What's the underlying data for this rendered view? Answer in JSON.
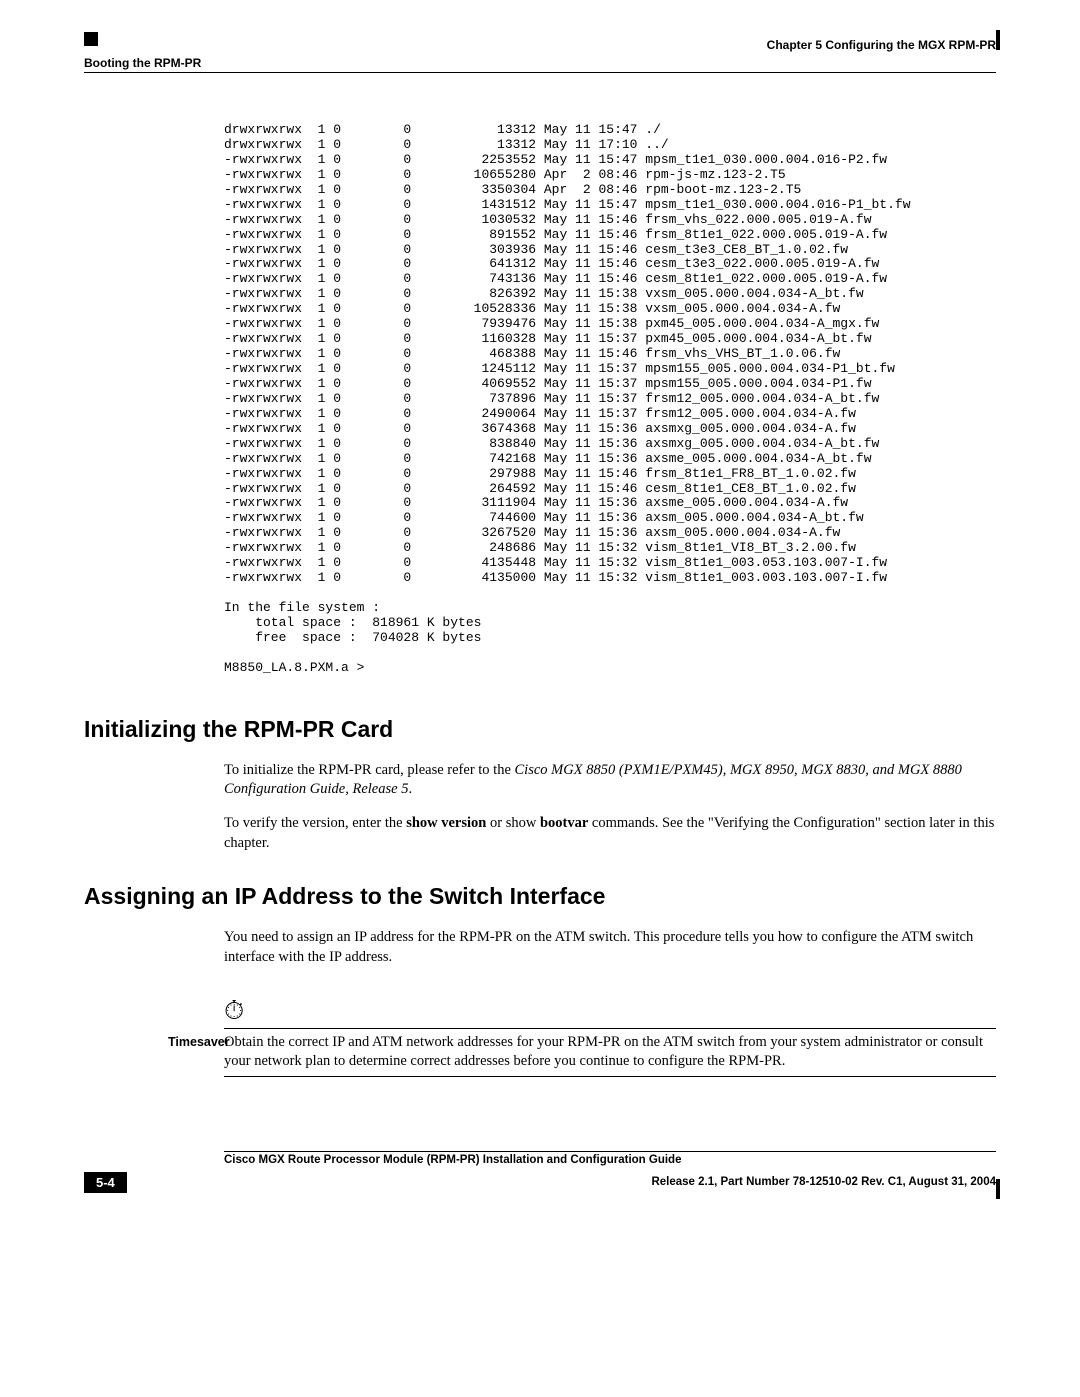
{
  "header": {
    "chapter_line": "Chapter 5    Configuring the MGX RPM-PR",
    "section_title": "Booting the RPM-PR"
  },
  "listing": {
    "rows": [
      {
        "perm": "drwxrwxrwx",
        "l": "1",
        "o": "0",
        "g": "0",
        "size": "13312",
        "date": "May 11 15:47",
        "name": "./"
      },
      {
        "perm": "drwxrwxrwx",
        "l": "1",
        "o": "0",
        "g": "0",
        "size": "13312",
        "date": "May 11 17:10",
        "name": "../"
      },
      {
        "perm": "-rwxrwxrwx",
        "l": "1",
        "o": "0",
        "g": "0",
        "size": "2253552",
        "date": "May 11 15:47",
        "name": "mpsm_t1e1_030.000.004.016-P2.fw"
      },
      {
        "perm": "-rwxrwxrwx",
        "l": "1",
        "o": "0",
        "g": "0",
        "size": "10655280",
        "date": "Apr  2 08:46",
        "name": "rpm-js-mz.123-2.T5"
      },
      {
        "perm": "-rwxrwxrwx",
        "l": "1",
        "o": "0",
        "g": "0",
        "size": "3350304",
        "date": "Apr  2 08:46",
        "name": "rpm-boot-mz.123-2.T5"
      },
      {
        "perm": "-rwxrwxrwx",
        "l": "1",
        "o": "0",
        "g": "0",
        "size": "1431512",
        "date": "May 11 15:47",
        "name": "mpsm_t1e1_030.000.004.016-P1_bt.fw"
      },
      {
        "perm": "-rwxrwxrwx",
        "l": "1",
        "o": "0",
        "g": "0",
        "size": "1030532",
        "date": "May 11 15:46",
        "name": "frsm_vhs_022.000.005.019-A.fw"
      },
      {
        "perm": "-rwxrwxrwx",
        "l": "1",
        "o": "0",
        "g": "0",
        "size": "891552",
        "date": "May 11 15:46",
        "name": "frsm_8t1e1_022.000.005.019-A.fw"
      },
      {
        "perm": "-rwxrwxrwx",
        "l": "1",
        "o": "0",
        "g": "0",
        "size": "303936",
        "date": "May 11 15:46",
        "name": "cesm_t3e3_CE8_BT_1.0.02.fw"
      },
      {
        "perm": "-rwxrwxrwx",
        "l": "1",
        "o": "0",
        "g": "0",
        "size": "641312",
        "date": "May 11 15:46",
        "name": "cesm_t3e3_022.000.005.019-A.fw"
      },
      {
        "perm": "-rwxrwxrwx",
        "l": "1",
        "o": "0",
        "g": "0",
        "size": "743136",
        "date": "May 11 15:46",
        "name": "cesm_8t1e1_022.000.005.019-A.fw"
      },
      {
        "perm": "-rwxrwxrwx",
        "l": "1",
        "o": "0",
        "g": "0",
        "size": "826392",
        "date": "May 11 15:38",
        "name": "vxsm_005.000.004.034-A_bt.fw"
      },
      {
        "perm": "-rwxrwxrwx",
        "l": "1",
        "o": "0",
        "g": "0",
        "size": "10528336",
        "date": "May 11 15:38",
        "name": "vxsm_005.000.004.034-A.fw"
      },
      {
        "perm": "-rwxrwxrwx",
        "l": "1",
        "o": "0",
        "g": "0",
        "size": "7939476",
        "date": "May 11 15:38",
        "name": "pxm45_005.000.004.034-A_mgx.fw"
      },
      {
        "perm": "-rwxrwxrwx",
        "l": "1",
        "o": "0",
        "g": "0",
        "size": "1160328",
        "date": "May 11 15:37",
        "name": "pxm45_005.000.004.034-A_bt.fw"
      },
      {
        "perm": "-rwxrwxrwx",
        "l": "1",
        "o": "0",
        "g": "0",
        "size": "468388",
        "date": "May 11 15:46",
        "name": "frsm_vhs_VHS_BT_1.0.06.fw"
      },
      {
        "perm": "-rwxrwxrwx",
        "l": "1",
        "o": "0",
        "g": "0",
        "size": "1245112",
        "date": "May 11 15:37",
        "name": "mpsm155_005.000.004.034-P1_bt.fw"
      },
      {
        "perm": "-rwxrwxrwx",
        "l": "1",
        "o": "0",
        "g": "0",
        "size": "4069552",
        "date": "May 11 15:37",
        "name": "mpsm155_005.000.004.034-P1.fw"
      },
      {
        "perm": "-rwxrwxrwx",
        "l": "1",
        "o": "0",
        "g": "0",
        "size": "737896",
        "date": "May 11 15:37",
        "name": "frsm12_005.000.004.034-A_bt.fw"
      },
      {
        "perm": "-rwxrwxrwx",
        "l": "1",
        "o": "0",
        "g": "0",
        "size": "2490064",
        "date": "May 11 15:37",
        "name": "frsm12_005.000.004.034-A.fw"
      },
      {
        "perm": "-rwxrwxrwx",
        "l": "1",
        "o": "0",
        "g": "0",
        "size": "3674368",
        "date": "May 11 15:36",
        "name": "axsmxg_005.000.004.034-A.fw"
      },
      {
        "perm": "-rwxrwxrwx",
        "l": "1",
        "o": "0",
        "g": "0",
        "size": "838840",
        "date": "May 11 15:36",
        "name": "axsmxg_005.000.004.034-A_bt.fw"
      },
      {
        "perm": "-rwxrwxrwx",
        "l": "1",
        "o": "0",
        "g": "0",
        "size": "742168",
        "date": "May 11 15:36",
        "name": "axsme_005.000.004.034-A_bt.fw"
      },
      {
        "perm": "-rwxrwxrwx",
        "l": "1",
        "o": "0",
        "g": "0",
        "size": "297988",
        "date": "May 11 15:46",
        "name": "frsm_8t1e1_FR8_BT_1.0.02.fw"
      },
      {
        "perm": "-rwxrwxrwx",
        "l": "1",
        "o": "0",
        "g": "0",
        "size": "264592",
        "date": "May 11 15:46",
        "name": "cesm_8t1e1_CE8_BT_1.0.02.fw"
      },
      {
        "perm": "-rwxrwxrwx",
        "l": "1",
        "o": "0",
        "g": "0",
        "size": "3111904",
        "date": "May 11 15:36",
        "name": "axsme_005.000.004.034-A.fw"
      },
      {
        "perm": "-rwxrwxrwx",
        "l": "1",
        "o": "0",
        "g": "0",
        "size": "744600",
        "date": "May 11 15:36",
        "name": "axsm_005.000.004.034-A_bt.fw"
      },
      {
        "perm": "-rwxrwxrwx",
        "l": "1",
        "o": "0",
        "g": "0",
        "size": "3267520",
        "date": "May 11 15:36",
        "name": "axsm_005.000.004.034-A.fw"
      },
      {
        "perm": "-rwxrwxrwx",
        "l": "1",
        "o": "0",
        "g": "0",
        "size": "248686",
        "date": "May 11 15:32",
        "name": "vism_8t1e1_VI8_BT_3.2.00.fw"
      },
      {
        "perm": "-rwxrwxrwx",
        "l": "1",
        "o": "0",
        "g": "0",
        "size": "4135448",
        "date": "May 11 15:32",
        "name": "vism_8t1e1_003.053.103.007-I.fw"
      },
      {
        "perm": "-rwxrwxrwx",
        "l": "1",
        "o": "0",
        "g": "0",
        "size": "4135000",
        "date": "May 11 15:32",
        "name": "vism_8t1e1_003.003.103.007-I.fw"
      }
    ],
    "fs_header": "In the file system :",
    "total": "    total space :  818961 K bytes",
    "free": "    free  space :  704028 K bytes",
    "prompt": "M8850_LA.8.PXM.a > "
  },
  "sections": {
    "init": {
      "heading": "Initializing the RPM-PR Card",
      "p1_a": "To initialize the RPM-PR card, please refer to the ",
      "p1_b": "Cisco MGX 8850 (PXM1E/PXM45), MGX 8950, MGX 8830, and MGX 8880 Configuration Guide, Release 5",
      "p1_c": ".",
      "p2_a": "To verify the version, enter the ",
      "p2_b": "show version",
      "p2_c": " or show ",
      "p2_d": "bootvar",
      "p2_e": " commands. See the ",
      "p2_link": "\"Verifying the Configuration\"",
      "p2_f": " section later in this chapter."
    },
    "ip": {
      "heading": "Assigning an IP Address to the Switch Interface",
      "p1": "You need to assign an IP address for the RPM-PR on the ATM switch. This procedure tells you how to configure the ATM switch interface with the IP address.",
      "note_label": "Timesaver",
      "note_text": "Obtain the correct IP and ATM network addresses for your RPM-PR on the ATM switch from your system administrator or consult your network plan to determine correct addresses before you continue to configure the RPM-PR."
    }
  },
  "footer": {
    "title": "Cisco MGX Route Processor Module (RPM-PR) Installation and Configuration Guide",
    "page_num": "5-4",
    "release": "Release 2.1, Part Number 78-12510-02 Rev. C1, August 31, 2004"
  }
}
